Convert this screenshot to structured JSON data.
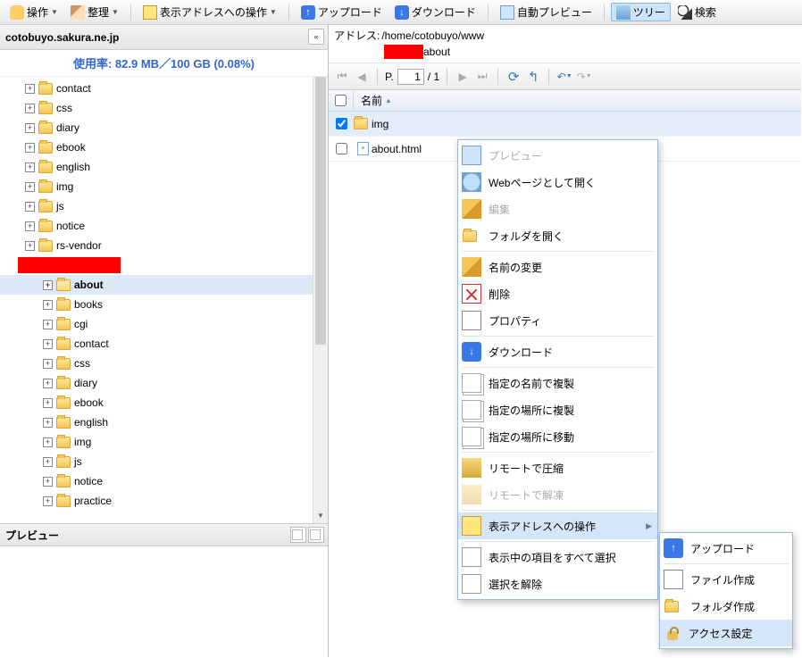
{
  "toolbar": {
    "operate": "操作",
    "organize": "整理",
    "addr_op": "表示アドレスへの操作",
    "upload": "アップロード",
    "download": "ダウンロード",
    "auto_preview": "自動プレビュー",
    "tree": "ツリー",
    "search": "検索"
  },
  "left": {
    "host": "cotobuyo.sakura.ne.jp",
    "usage": "使用率: 82.9 MB／100 GB (0.08%)",
    "tree_top": [
      "contact",
      "css",
      "diary",
      "ebook",
      "english",
      "img",
      "js",
      "notice",
      "rs-vendor"
    ],
    "tree_selected": "about",
    "tree_sub": [
      "books",
      "cgi",
      "contact",
      "css",
      "diary",
      "ebook",
      "english",
      "img",
      "js",
      "notice",
      "practice"
    ],
    "preview": "プレビュー"
  },
  "right": {
    "addr_label": "アドレス:",
    "addr_path": "/home/cotobuyo/www",
    "addr_sub": "about",
    "pager": {
      "label": "P.",
      "page": "1",
      "total": "/ 1"
    },
    "header": {
      "name": "名前"
    },
    "files": [
      {
        "name": "img",
        "type": "folder",
        "checked": true,
        "selected": true
      },
      {
        "name": "about.html",
        "type": "page",
        "checked": false,
        "selected": false
      }
    ]
  },
  "ctx": {
    "preview": "プレビュー",
    "open_web": "Webページとして開く",
    "edit": "編集",
    "open_folder": "フォルダを開く",
    "rename": "名前の変更",
    "delete": "削除",
    "property": "プロパティ",
    "download": "ダウンロード",
    "dup_name": "指定の名前で複製",
    "dup_loc": "指定の場所に複製",
    "move_loc": "指定の場所に移動",
    "compress": "リモートで圧縮",
    "extract": "リモートで解凍",
    "addr_op": "表示アドレスへの操作",
    "select_all": "表示中の項目をすべて選択",
    "deselect": "選択を解除"
  },
  "sub": {
    "upload": "アップロード",
    "new_file": "ファイル作成",
    "new_folder": "フォルダ作成",
    "access": "アクセス設定"
  }
}
